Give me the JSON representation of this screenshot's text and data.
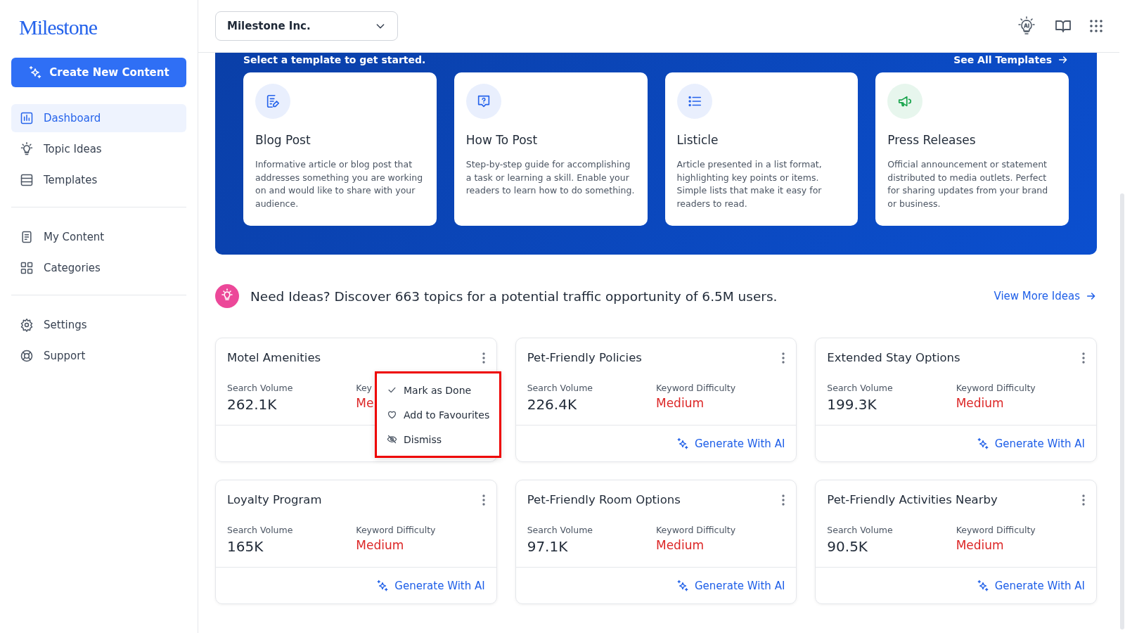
{
  "sidebar": {
    "logo": "Milestone",
    "create_button": "Create New Content",
    "groups": [
      [
        {
          "label": "Dashboard",
          "kind": "dashboard",
          "selected": true
        },
        {
          "label": "Topic Ideas",
          "kind": "bulb",
          "selected": false
        },
        {
          "label": "Templates",
          "kind": "templates",
          "selected": false
        }
      ],
      [
        {
          "label": "My Content",
          "kind": "doc",
          "selected": false
        },
        {
          "label": "Categories",
          "kind": "grid",
          "selected": false
        }
      ],
      [
        {
          "label": "Settings",
          "kind": "gear",
          "selected": false
        },
        {
          "label": "Support",
          "kind": "support",
          "selected": false
        }
      ]
    ]
  },
  "header": {
    "org_select": "Milestone Inc."
  },
  "templates": {
    "subtitle": "Select a template to get started.",
    "see_all": "See All Templates",
    "items": [
      {
        "kind": "blog",
        "color": "#2563eb",
        "title": "Blog Post",
        "description": "Informative article or blog post that addresses something you are working on and would like to share with your audience."
      },
      {
        "kind": "howto",
        "color": "#2563eb",
        "title": "How To Post",
        "description": "Step-by-step guide for accomplishing a task or learning a skill. Enable your readers to learn how to do something."
      },
      {
        "kind": "list",
        "color": "#2563eb",
        "title": "Listicle",
        "description": "Article presented in a list format, highlighting key points or items. Simple lists that make it easy for readers to read."
      },
      {
        "kind": "press",
        "color": "#16a34a",
        "title": "Press Releases",
        "description": "Official announcement or statement distributed to media outlets. Perfect for sharing updates from your brand or business."
      }
    ]
  },
  "ideas": {
    "headline": "Need Ideas? Discover 663 topics for a potential traffic opportunity of 6.5M users.",
    "view_more": "View More Ideas",
    "topics": [
      {
        "title": "Motel Amenities",
        "volume_label": "Search Volume",
        "volume": "262.1K",
        "difficulty_label": "Key",
        "difficulty": "Me",
        "menu": [
          "Mark as Done",
          "Add to Favourites",
          "Dismiss"
        ]
      },
      {
        "title": "Pet-Friendly Policies",
        "volume_label": "Search Volume",
        "volume": "226.4K",
        "difficulty_label": "Keyword Difficulty",
        "difficulty": "Medium",
        "action": "Generate With AI"
      },
      {
        "title": "Extended Stay Options",
        "volume_label": "Search Volume",
        "volume": "199.3K",
        "difficulty_label": "Keyword Difficulty",
        "difficulty": "Medium",
        "action": "Generate With AI"
      },
      {
        "title": "Loyalty Program",
        "volume_label": "Search Volume",
        "volume": "165K",
        "difficulty_label": "Keyword Difficulty",
        "difficulty": "Medium",
        "action": "Generate With AI"
      },
      {
        "title": "Pet-Friendly Room Options",
        "volume_label": "Search Volume",
        "volume": "97.1K",
        "difficulty_label": "Keyword Difficulty",
        "difficulty": "Medium",
        "action": "Generate With AI"
      },
      {
        "title": "Pet-Friendly Activities Nearby",
        "volume_label": "Search Volume",
        "volume": "90.5K",
        "difficulty_label": "Keyword Difficulty",
        "difficulty": "Medium",
        "action": "Generate With AI"
      }
    ]
  }
}
